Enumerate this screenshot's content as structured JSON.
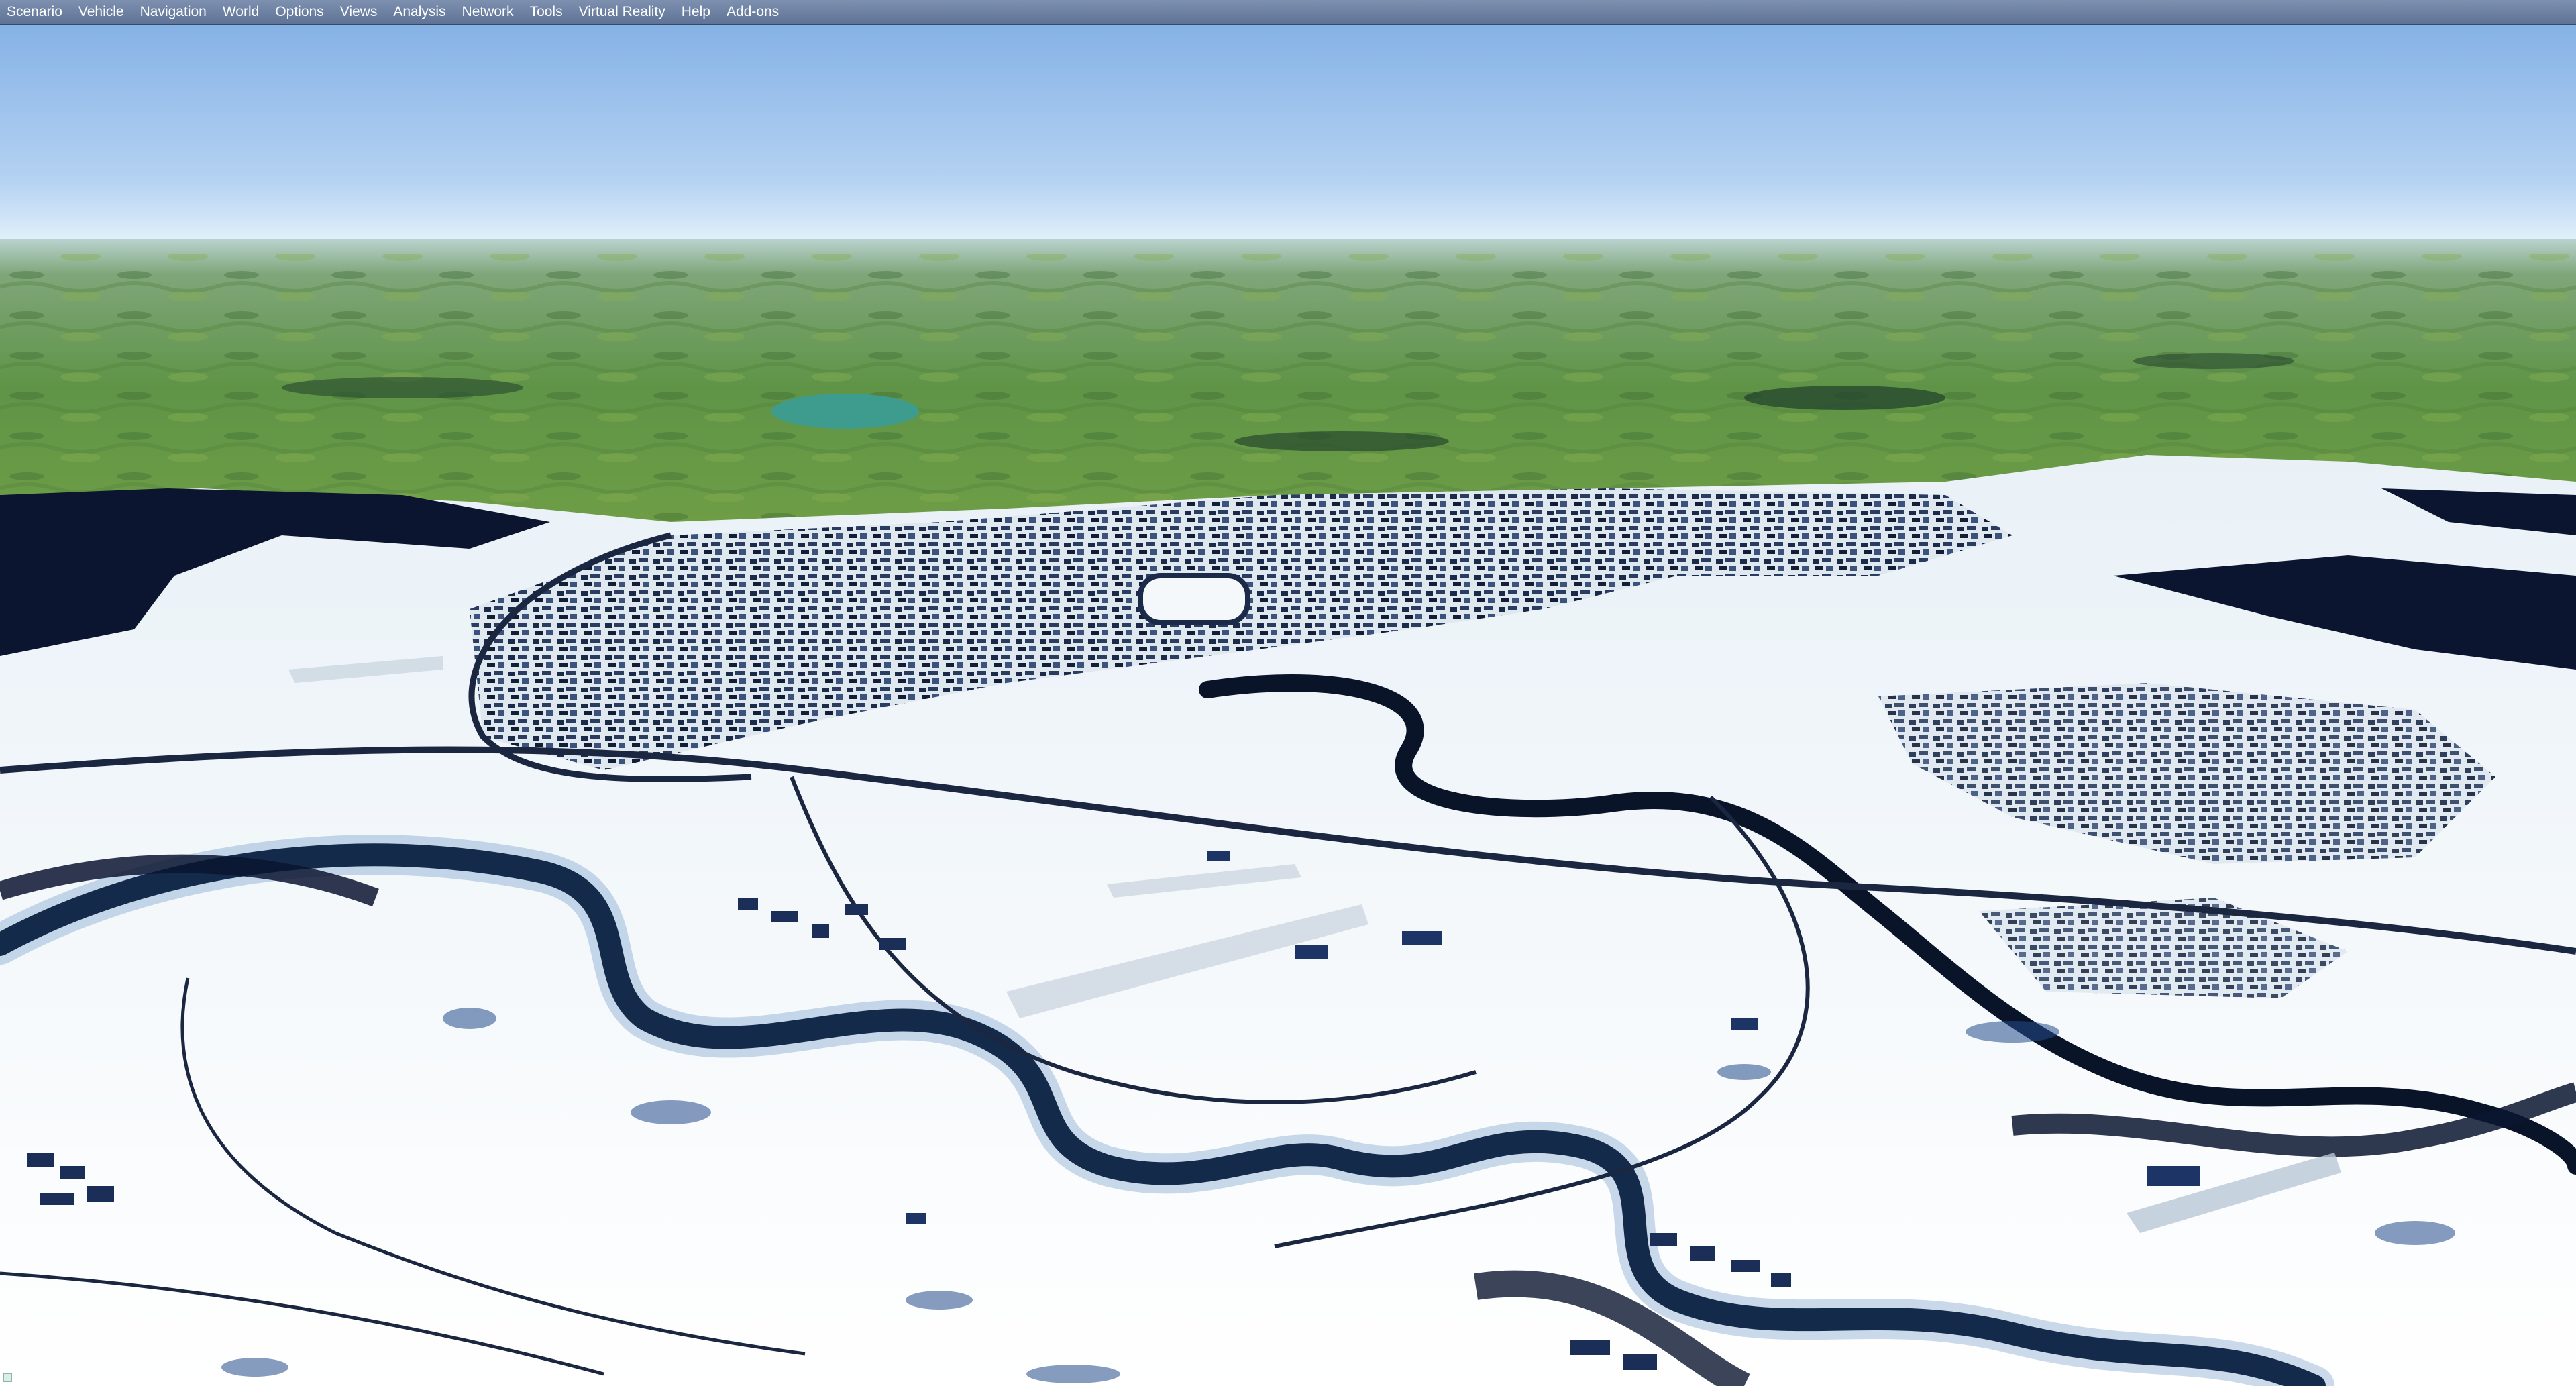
{
  "menubar": {
    "items": [
      {
        "label": "Scenario"
      },
      {
        "label": "Vehicle"
      },
      {
        "label": "Navigation"
      },
      {
        "label": "World"
      },
      {
        "label": "Options"
      },
      {
        "label": "Views"
      },
      {
        "label": "Analysis"
      },
      {
        "label": "Network"
      },
      {
        "label": "Tools"
      },
      {
        "label": "Virtual Reality"
      },
      {
        "label": "Help"
      },
      {
        "label": "Add-ons"
      }
    ]
  },
  "scene": {
    "description_colors": {
      "sky_top": "#8cb8e8",
      "sky_horizon": "#dfeefa",
      "far_terrain": "#6a9a4c",
      "snow": "#f4f8fb",
      "forest_shadow": "#0c1730",
      "water": "#3a9a8c"
    }
  }
}
